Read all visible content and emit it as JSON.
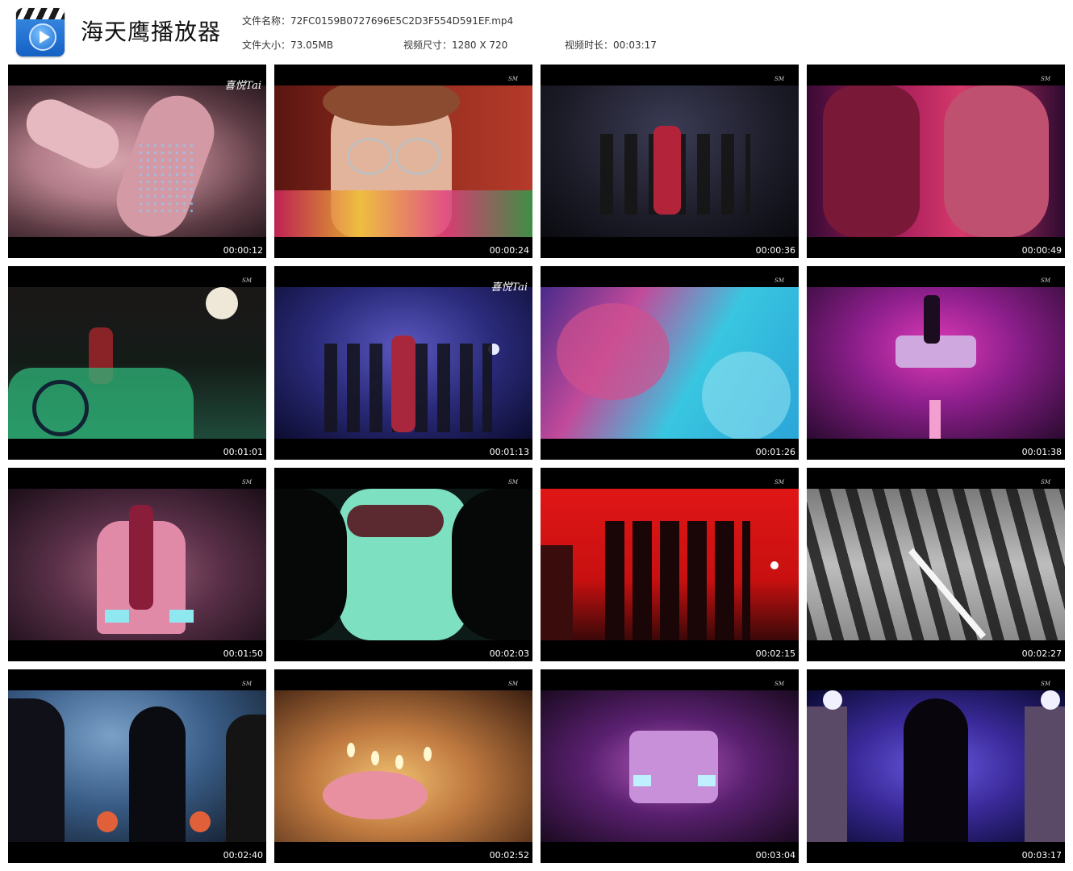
{
  "header": {
    "app_title": "海天鹰播放器",
    "logo_icon": "video-player-icon",
    "file_name": "文件名称：72FC0159B0727696E5C2D3F554D591EF.mp4",
    "file_size": "文件大小：73.05MB",
    "video_dimension": "视频尺寸：1280 X 720",
    "video_duration": "视频时长：00:03:17"
  },
  "watermark": "SM",
  "watermark_alt": "喜悦Tai",
  "thumbnails": [
    {
      "time": "00:00:12",
      "scene": "hand-rhinestone-leg",
      "watermark": "喜悦Tai"
    },
    {
      "time": "00:00:24",
      "scene": "woman-glasses-closeup",
      "watermark": "SM"
    },
    {
      "time": "00:00:36",
      "scene": "dancers-group",
      "watermark": "SM"
    },
    {
      "time": "00:00:49",
      "scene": "couple-kiss",
      "watermark": "SM"
    },
    {
      "time": "00:01:01",
      "scene": "woman-window-green",
      "watermark": "SM"
    },
    {
      "time": "00:01:13",
      "scene": "dancers-blue-stage",
      "watermark": "喜悦Tai"
    },
    {
      "time": "00:01:26",
      "scene": "colored-smoke",
      "watermark": "SM"
    },
    {
      "time": "00:01:38",
      "scene": "car-pink-fog",
      "watermark": "SM"
    },
    {
      "time": "00:01:50",
      "scene": "woman-on-pink-car",
      "watermark": "SM"
    },
    {
      "time": "00:02:03",
      "scene": "rearview-mirror",
      "watermark": "SM"
    },
    {
      "time": "00:02:15",
      "scene": "silhouettes-red",
      "watermark": "SM"
    },
    {
      "time": "00:02:27",
      "scene": "shadows-road",
      "watermark": "SM"
    },
    {
      "time": "00:02:40",
      "scene": "silhouette-blue",
      "watermark": "SM"
    },
    {
      "time": "00:02:52",
      "scene": "birthday-cake",
      "watermark": "SM"
    },
    {
      "time": "00:03:04",
      "scene": "car-purple-fog",
      "watermark": "SM"
    },
    {
      "time": "00:03:17",
      "scene": "woman-hat-gate",
      "watermark": "SM"
    }
  ]
}
